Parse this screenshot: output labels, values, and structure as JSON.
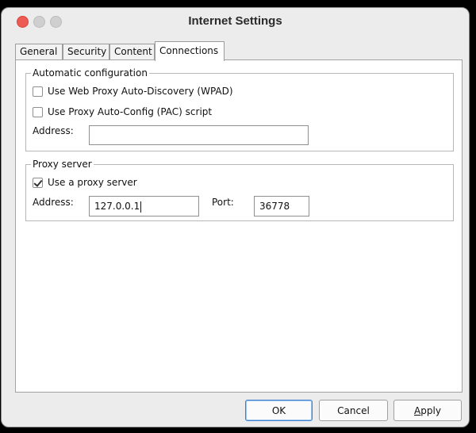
{
  "window": {
    "title": "Internet Settings"
  },
  "tabs": [
    {
      "label": "General",
      "active": false
    },
    {
      "label": "Security",
      "active": false
    },
    {
      "label": "Content",
      "active": false
    },
    {
      "label": "Connections",
      "active": true
    }
  ],
  "auto_config": {
    "legend": "Automatic configuration",
    "wpad_label": "Use Web Proxy Auto-Discovery (WPAD)",
    "wpad_checked": false,
    "pac_label": "Use Proxy Auto-Config (PAC) script",
    "pac_checked": false,
    "address_label": "Address:",
    "address_value": ""
  },
  "proxy": {
    "legend": "Proxy server",
    "use_proxy_label": "Use a proxy server",
    "use_proxy_checked": true,
    "address_label": "Address:",
    "address_value": "127.0.0.1",
    "port_label": "Port:",
    "port_value": "36778"
  },
  "buttons": {
    "ok": "OK",
    "cancel": "Cancel",
    "apply_first": "A",
    "apply_rest": "pply"
  },
  "colors": {
    "close": "#ee5b54",
    "default_button_border": "#3f7fcf"
  }
}
